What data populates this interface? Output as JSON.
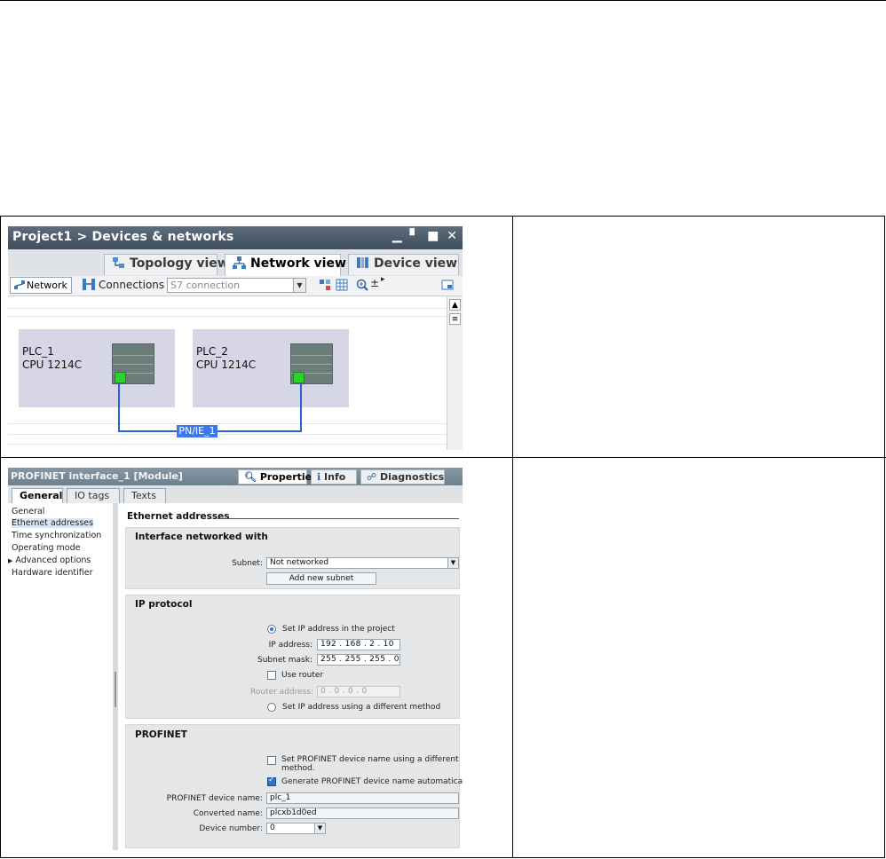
{
  "network_view": {
    "title": "Project1 > Devices & networks",
    "window_controls": [
      "▁",
      "▘",
      "■",
      "✕"
    ],
    "tabs": [
      {
        "label": "Topology view",
        "icon": "topology-icon"
      },
      {
        "label": "Network view",
        "icon": "network-icon",
        "active": true
      },
      {
        "label": "Device view",
        "icon": "device-icon"
      }
    ],
    "toolbar": {
      "network_label": "Network",
      "connections_label": "Connections",
      "connection_type": "S7 connection"
    },
    "devices": [
      {
        "name": "PLC_1",
        "type": "CPU 1214C"
      },
      {
        "name": "PLC_2",
        "type": "CPU 1214C"
      }
    ],
    "subnet_label": "PN/IE_1"
  },
  "properties": {
    "title": "PROFINET interface_1 [Module]",
    "inspector_tabs": [
      "Properties",
      "Info",
      "Diagnostics"
    ],
    "tabs": [
      "General",
      "IO tags",
      "Texts"
    ],
    "nav": [
      "General",
      "Ethernet addresses",
      "Time synchronization",
      "Operating mode",
      "Advanced options",
      "Hardware identifier"
    ],
    "section_title": "Ethernet addresses",
    "interface": {
      "heading": "Interface networked with",
      "subnet_label": "Subnet:",
      "subnet_value": "Not networked",
      "add_button": "Add new subnet"
    },
    "ip": {
      "heading": "IP protocol",
      "opt_project": "Set IP address in the project",
      "ip_label": "IP address:",
      "ip_octets": [
        "192",
        "168",
        "2",
        "10"
      ],
      "mask_label": "Subnet mask:",
      "mask_octets": [
        "255",
        "255",
        "255",
        "0"
      ],
      "use_router": "Use router",
      "router_label": "Router address:",
      "router_octets": [
        "0",
        "0",
        "0",
        "0"
      ],
      "opt_other": "Set IP address using a different method"
    },
    "profinet": {
      "heading": "PROFINET",
      "opt_different": "Set PROFINET device name using a different method.",
      "opt_generate": "Generate PROFINET device name automatically",
      "device_name_label": "PROFINET device name:",
      "device_name": "plc_1",
      "converted_label": "Converted name:",
      "converted_name": "plcxb1d0ed",
      "number_label": "Device number:",
      "number": "0"
    }
  }
}
